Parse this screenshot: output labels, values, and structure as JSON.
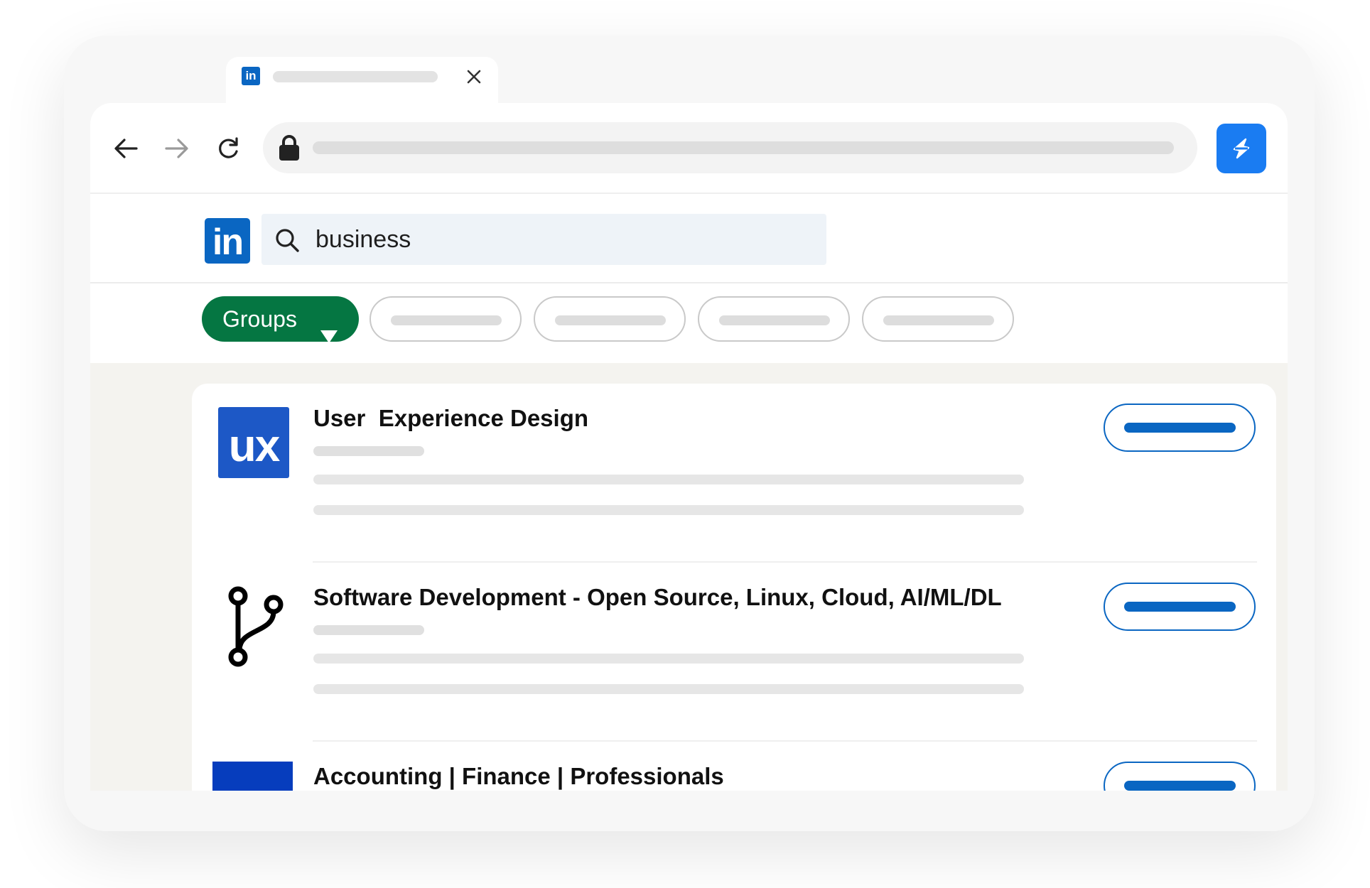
{
  "browser": {
    "tab": {
      "favicon": "in",
      "close_icon": "×"
    },
    "toolbar": {
      "back_icon": "arrow-left-icon",
      "forward_icon": "arrow-right-icon",
      "reload_icon": "reload-icon",
      "lock_icon": "lock-icon",
      "extension_icon": "lightning-icon"
    }
  },
  "linkedin": {
    "logo": "in",
    "search": {
      "value": "business"
    },
    "filters": {
      "active": "Groups"
    },
    "results": [
      {
        "name": "User  Experience Design",
        "logo_text": "ux"
      },
      {
        "name": "Software Development - Open Source, Linux, Cloud, AI/ML/DL",
        "logo_icon": "git-branch-icon"
      },
      {
        "name": "Accounting | Finance | Professionals"
      }
    ]
  },
  "colors": {
    "linkedin_blue": "#0a66c2",
    "active_filter_green": "#057642",
    "extension_blue": "#1a7cf2",
    "results_background": "#f4f3ef"
  }
}
